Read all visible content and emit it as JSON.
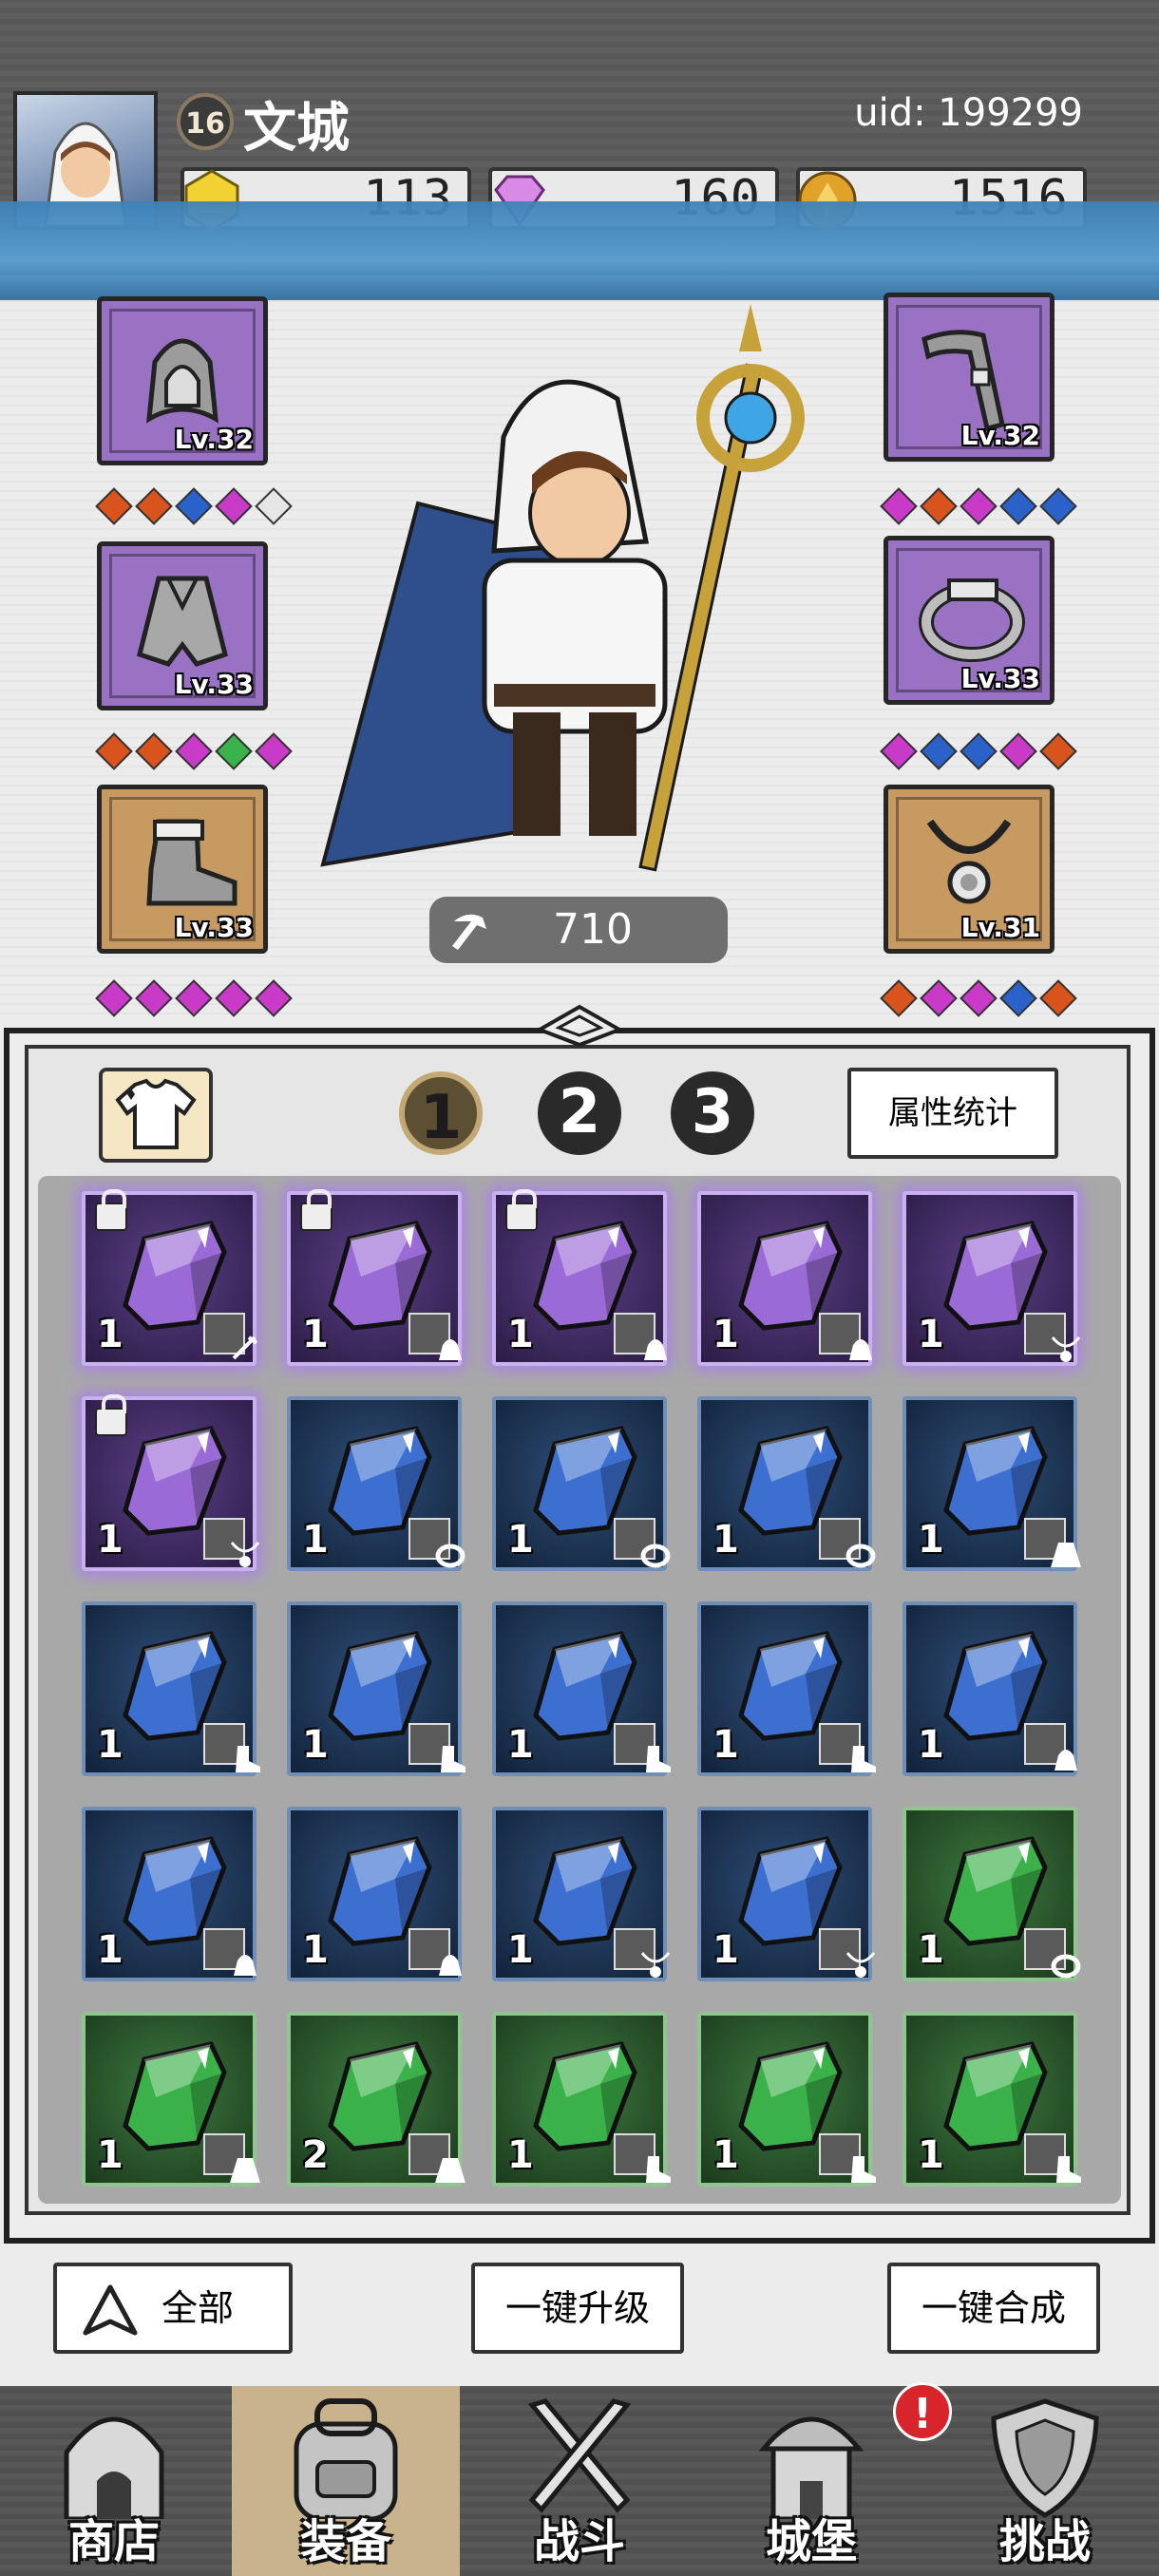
{
  "header": {
    "level": "16",
    "player_name": "文城",
    "uid": "uid: 199299",
    "resources": [
      {
        "icon": "yellow-gem-icon",
        "value": "113"
      },
      {
        "icon": "purple-diamond-icon",
        "value": "160"
      },
      {
        "icon": "gold-coin-icon",
        "value": "1516"
      }
    ]
  },
  "equipment": {
    "left": [
      {
        "icon": "hood-icon",
        "level": "Lv.32",
        "color": "purple",
        "gems": [
          "#d9541c",
          "#d9541c",
          "#2a62c9",
          "#c93ac9",
          "#e6e6e6"
        ]
      },
      {
        "icon": "cloak-icon",
        "level": "Lv.33",
        "color": "purple",
        "gems": [
          "#d9541c",
          "#d9541c",
          "#c93ac9",
          "#3ab44a",
          "#c93ac9"
        ]
      },
      {
        "icon": "boot-icon",
        "level": "Lv.33",
        "color": "orange",
        "gems": [
          "#c93ac9",
          "#c93ac9",
          "#c93ac9",
          "#c93ac9",
          "#c93ac9"
        ]
      }
    ],
    "right": [
      {
        "icon": "staff-icon",
        "level": "Lv.32",
        "color": "purple",
        "gems": [
          "#c93ac9",
          "#d9541c",
          "#c93ac9",
          "#2a62c9",
          "#2a62c9"
        ]
      },
      {
        "icon": "ring-icon",
        "level": "Lv.33",
        "color": "purple",
        "gems": [
          "#c93ac9",
          "#2a62c9",
          "#2a62c9",
          "#c93ac9",
          "#d9541c"
        ]
      },
      {
        "icon": "amulet-icon",
        "level": "Lv.31",
        "color": "orange",
        "gems": [
          "#d9541c",
          "#c93ac9",
          "#c93ac9",
          "#2a62c9",
          "#d9541c"
        ]
      }
    ]
  },
  "power": "710",
  "inventory": {
    "pages": [
      "1",
      "2",
      "3"
    ],
    "active_page": "1",
    "stats_label": "属性统计",
    "rows": [
      [
        {
          "color": "purple",
          "count": "1",
          "locked": true,
          "type": "staff"
        },
        {
          "color": "purple",
          "count": "1",
          "locked": true,
          "type": "hood"
        },
        {
          "color": "purple",
          "count": "1",
          "locked": true,
          "type": "hood"
        },
        {
          "color": "purple",
          "count": "1",
          "locked": false,
          "type": "hood"
        },
        {
          "color": "purple",
          "count": "1",
          "locked": false,
          "type": "amulet"
        }
      ],
      [
        {
          "color": "purple",
          "count": "1",
          "locked": true,
          "type": "amulet"
        },
        {
          "color": "blue",
          "count": "1",
          "locked": false,
          "type": "ring"
        },
        {
          "color": "blue",
          "count": "1",
          "locked": false,
          "type": "ring"
        },
        {
          "color": "blue",
          "count": "1",
          "locked": false,
          "type": "ring"
        },
        {
          "color": "blue",
          "count": "1",
          "locked": false,
          "type": "cloak"
        }
      ],
      [
        {
          "color": "blue",
          "count": "1",
          "locked": false,
          "type": "boot"
        },
        {
          "color": "blue",
          "count": "1",
          "locked": false,
          "type": "boot"
        },
        {
          "color": "blue",
          "count": "1",
          "locked": false,
          "type": "boot"
        },
        {
          "color": "blue",
          "count": "1",
          "locked": false,
          "type": "boot"
        },
        {
          "color": "blue",
          "count": "1",
          "locked": false,
          "type": "hood"
        }
      ],
      [
        {
          "color": "blue",
          "count": "1",
          "locked": false,
          "type": "hood"
        },
        {
          "color": "blue",
          "count": "1",
          "locked": false,
          "type": "hood"
        },
        {
          "color": "blue",
          "count": "1",
          "locked": false,
          "type": "amulet"
        },
        {
          "color": "blue",
          "count": "1",
          "locked": false,
          "type": "amulet"
        },
        {
          "color": "green",
          "count": "1",
          "locked": false,
          "type": "ring"
        }
      ],
      [
        {
          "color": "green",
          "count": "1",
          "locked": false,
          "type": "cloak"
        },
        {
          "color": "green",
          "count": "2",
          "locked": false,
          "type": "cloak"
        },
        {
          "color": "green",
          "count": "1",
          "locked": false,
          "type": "boot"
        },
        {
          "color": "green",
          "count": "1",
          "locked": false,
          "type": "boot"
        },
        {
          "color": "green",
          "count": "1",
          "locked": false,
          "type": "boot"
        }
      ]
    ]
  },
  "actions": {
    "filter_label": "全部",
    "upgrade_label": "一键升级",
    "merge_label": "一键合成"
  },
  "nav": [
    {
      "label": "商店",
      "icon": "shop-icon",
      "active": false
    },
    {
      "label": "装备",
      "icon": "backpack-icon",
      "active": true
    },
    {
      "label": "战斗",
      "icon": "crossed-swords-icon",
      "active": false
    },
    {
      "label": "城堡",
      "icon": "castle-icon",
      "active": false
    },
    {
      "label": "挑战",
      "icon": "shield-icon",
      "active": false
    }
  ],
  "notification_badge": "!"
}
